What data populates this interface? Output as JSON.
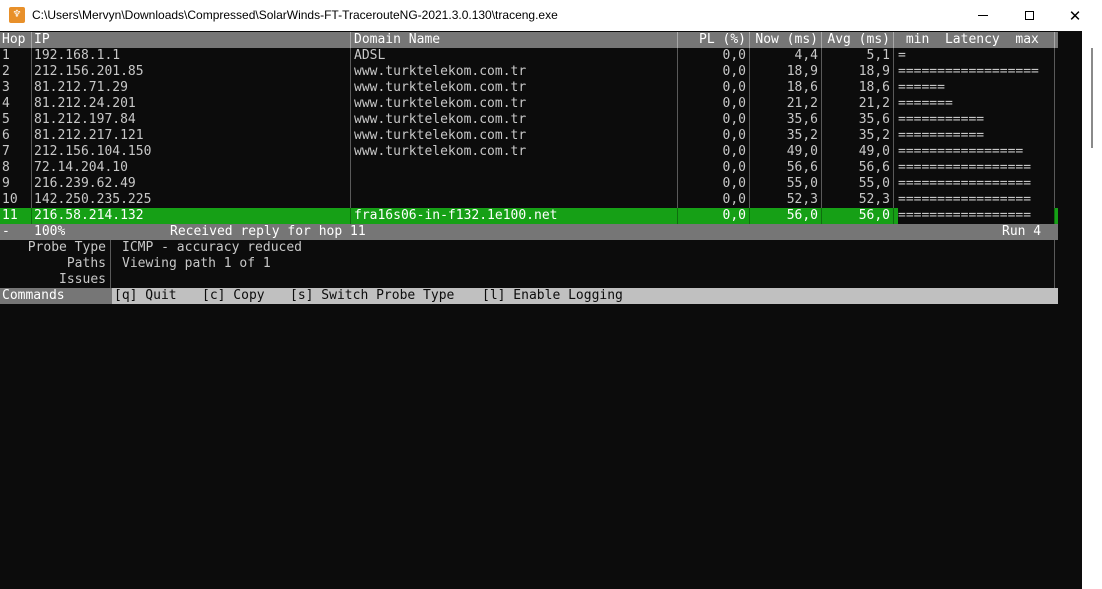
{
  "window": {
    "icon_glyph": "♆",
    "title": "C:\\Users\\Mervyn\\Downloads\\Compressed\\SolarWinds-FT-TracerouteNG-2021.3.0.130\\traceng.exe",
    "close_glyph": "✕"
  },
  "table": {
    "headers": {
      "hop": "Hop",
      "ip": "IP",
      "domain": "Domain Name",
      "pl": "PL (%)",
      "now": "Now (ms)",
      "avg": "Avg (ms)",
      "latency": " min  Latency  max"
    },
    "rows": [
      {
        "hop": "1",
        "ip": "192.168.1.1",
        "domain": "ADSL",
        "pl": "0,0",
        "now": "4,4",
        "avg": "5,1",
        "bar": "="
      },
      {
        "hop": "2",
        "ip": "212.156.201.85",
        "domain": "www.turktelekom.com.tr",
        "pl": "0,0",
        "now": "18,9",
        "avg": "18,9",
        "bar": "=================="
      },
      {
        "hop": "3",
        "ip": "81.212.71.29",
        "domain": "www.turktelekom.com.tr",
        "pl": "0,0",
        "now": "18,6",
        "avg": "18,6",
        "bar": "======"
      },
      {
        "hop": "4",
        "ip": "81.212.24.201",
        "domain": "www.turktelekom.com.tr",
        "pl": "0,0",
        "now": "21,2",
        "avg": "21,2",
        "bar": "======="
      },
      {
        "hop": "5",
        "ip": "81.212.197.84",
        "domain": "www.turktelekom.com.tr",
        "pl": "0,0",
        "now": "35,6",
        "avg": "35,6",
        "bar": "==========="
      },
      {
        "hop": "6",
        "ip": "81.212.217.121",
        "domain": "www.turktelekom.com.tr",
        "pl": "0,0",
        "now": "35,2",
        "avg": "35,2",
        "bar": "==========="
      },
      {
        "hop": "7",
        "ip": "212.156.104.150",
        "domain": "www.turktelekom.com.tr",
        "pl": "0,0",
        "now": "49,0",
        "avg": "49,0",
        "bar": "================"
      },
      {
        "hop": "8",
        "ip": "72.14.204.10",
        "domain": "",
        "pl": "0,0",
        "now": "56,6",
        "avg": "56,6",
        "bar": "================="
      },
      {
        "hop": "9",
        "ip": "216.239.62.49",
        "domain": "",
        "pl": "0,0",
        "now": "55,0",
        "avg": "55,0",
        "bar": "================="
      },
      {
        "hop": "10",
        "ip": "142.250.235.225",
        "domain": "",
        "pl": "0,0",
        "now": "52,3",
        "avg": "52,3",
        "bar": "================="
      },
      {
        "hop": "11",
        "ip": "216.58.214.132",
        "domain": "fra16s06-in-f132.1e100.net",
        "pl": "0,0",
        "now": "56,0",
        "avg": "56,0",
        "bar": "================="
      }
    ]
  },
  "status": {
    "dash": "-",
    "percent": "100%",
    "message": "Received reply for hop 11",
    "run": "Run 4"
  },
  "info": [
    {
      "label": "Probe Type",
      "value": "ICMP - accuracy reduced"
    },
    {
      "label": "Paths",
      "value": "Viewing path 1 of 1"
    },
    {
      "label": "Issues",
      "value": ""
    }
  ],
  "commands": {
    "label": "Commands",
    "items": [
      "[q] Quit",
      "[c] Copy",
      "[s] Switch Probe Type",
      "[l] Enable Logging"
    ]
  },
  "colors": {
    "console_bg": "#0c0c0c",
    "header_bg": "#767676",
    "highlight_bg": "#16a016",
    "commands_bg": "#c0c0c0"
  }
}
